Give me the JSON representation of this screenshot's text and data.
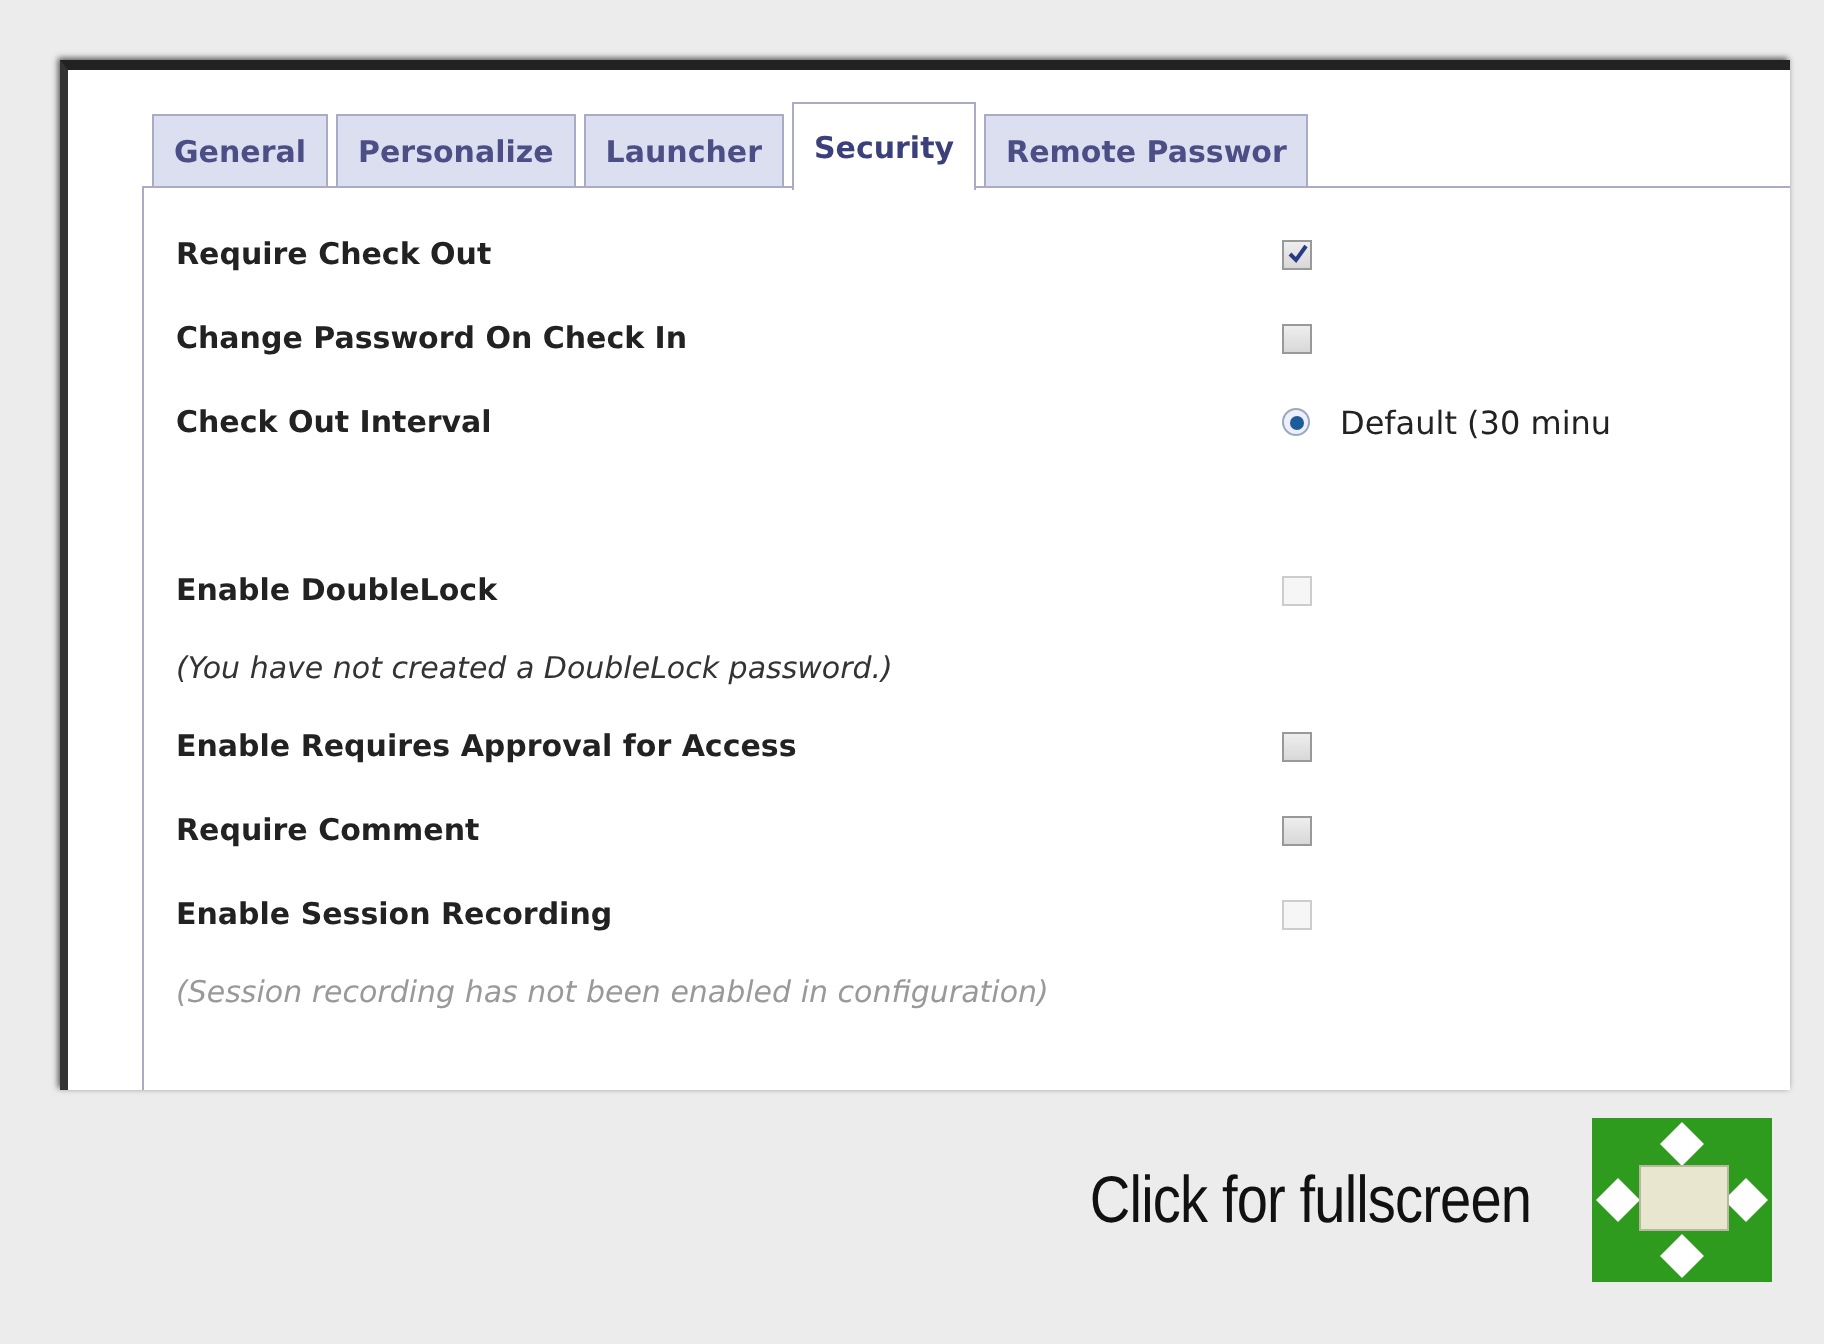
{
  "tabs": [
    {
      "label": "General",
      "selected": false
    },
    {
      "label": "Personalize",
      "selected": false
    },
    {
      "label": "Launcher",
      "selected": false
    },
    {
      "label": "Security",
      "selected": true
    },
    {
      "label": "Remote Passwor",
      "selected": false
    }
  ],
  "rows": [
    {
      "kind": "checkbox",
      "label": "Require Check Out",
      "checked": true,
      "disabled": false
    },
    {
      "kind": "checkbox",
      "label": "Change Password On Check In",
      "checked": false,
      "disabled": false
    },
    {
      "kind": "radio",
      "label": "Check Out Interval",
      "option": "Default (30 minu",
      "selected": true
    },
    {
      "kind": "checkbox",
      "label": "Enable DoubleLock",
      "checked": false,
      "disabled": true
    },
    {
      "kind": "note",
      "text": "(You have not created a DoubleLock password.)",
      "disabled": false
    },
    {
      "kind": "checkbox",
      "label": "Enable Requires Approval for Access",
      "checked": false,
      "disabled": false
    },
    {
      "kind": "checkbox",
      "label": "Require Comment",
      "checked": false,
      "disabled": false
    },
    {
      "kind": "checkbox",
      "label": "Enable Session Recording",
      "checked": false,
      "disabled": true
    },
    {
      "kind": "note",
      "text": "(Session recording has not been enabled in configuration)",
      "disabled": true
    }
  ],
  "footer": {
    "label": "Click for fullscreen"
  }
}
